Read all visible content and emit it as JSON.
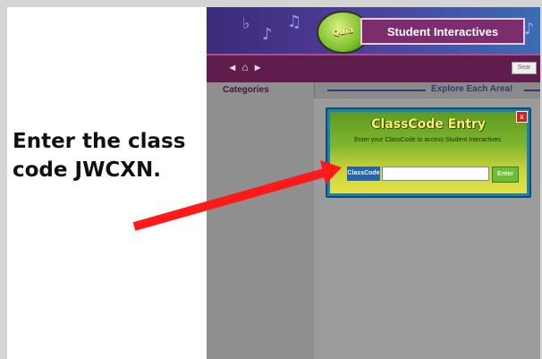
{
  "instruction": {
    "text": "Enter the class\ncode JWCXN."
  },
  "app": {
    "logo_text": "Quia",
    "title": "Student Interactives"
  },
  "nav": {
    "arrows": "◂ ⌂ ▸",
    "search_label": "Sear"
  },
  "sidebar": {
    "heading": "Categories"
  },
  "main": {
    "heading": "Explore Each Area!"
  },
  "dialog": {
    "title": "ClassCode Entry",
    "subtitle": "Enter your ClassCode to access Student Interactives.",
    "code_label": "ClassCode",
    "code_value": "",
    "enter_label": "Enter",
    "close_label": "x"
  },
  "colors": {
    "arrow": "#ff1a1a",
    "banner": "#4e3b96",
    "navbar": "#5e1d4a"
  }
}
